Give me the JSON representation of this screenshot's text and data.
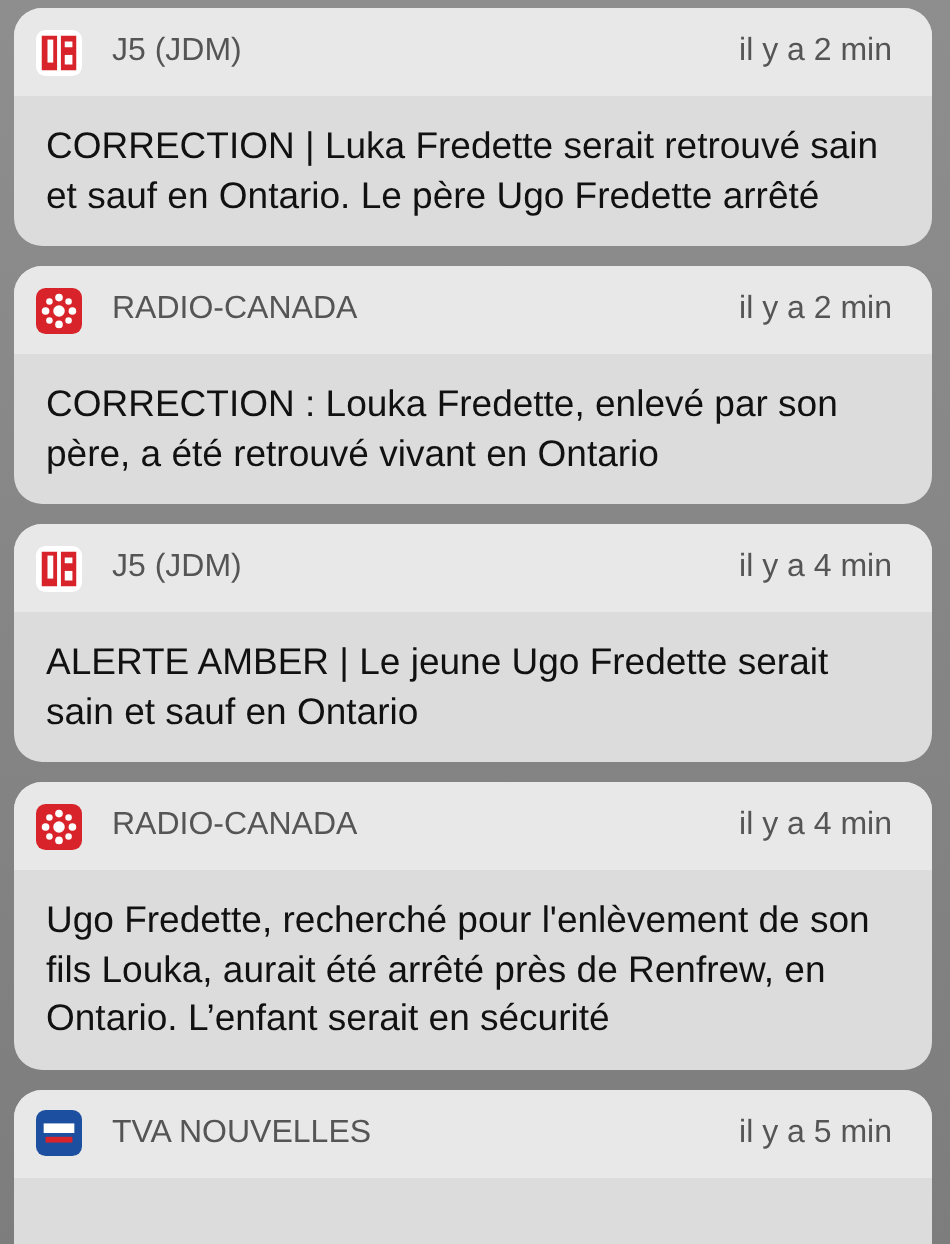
{
  "notifications": [
    {
      "app": "J5 (JDM)",
      "kind": "j5",
      "time": "il y a 2 min",
      "text": "CORRECTION | Luka Fredette serait retrouvé sain et sauf en Ontario. Le père Ugo Fredette arrêté"
    },
    {
      "app": "RADIO-CANADA",
      "kind": "radio-canada",
      "time": "il y a 2 min",
      "text": "CORRECTION : Louka Fredette, enlevé par son père, a été retrouvé vivant en Ontario"
    },
    {
      "app": "J5 (JDM)",
      "kind": "j5",
      "time": "il y a 4 min",
      "text": "ALERTE AMBER | Le jeune Ugo Fredette serait sain et sauf en Ontario"
    },
    {
      "app": "RADIO-CANADA",
      "kind": "radio-canada",
      "time": "il y a 4 min",
      "text": "Ugo Fredette, recherché pour l'enlèvement de son fils Louka, aurait été arrêté près de Renfrew, en Ontario. L’enfant serait en sécurité"
    },
    {
      "app": "TVA NOUVELLES",
      "kind": "tva",
      "time": "il y a 5 min"
    }
  ]
}
